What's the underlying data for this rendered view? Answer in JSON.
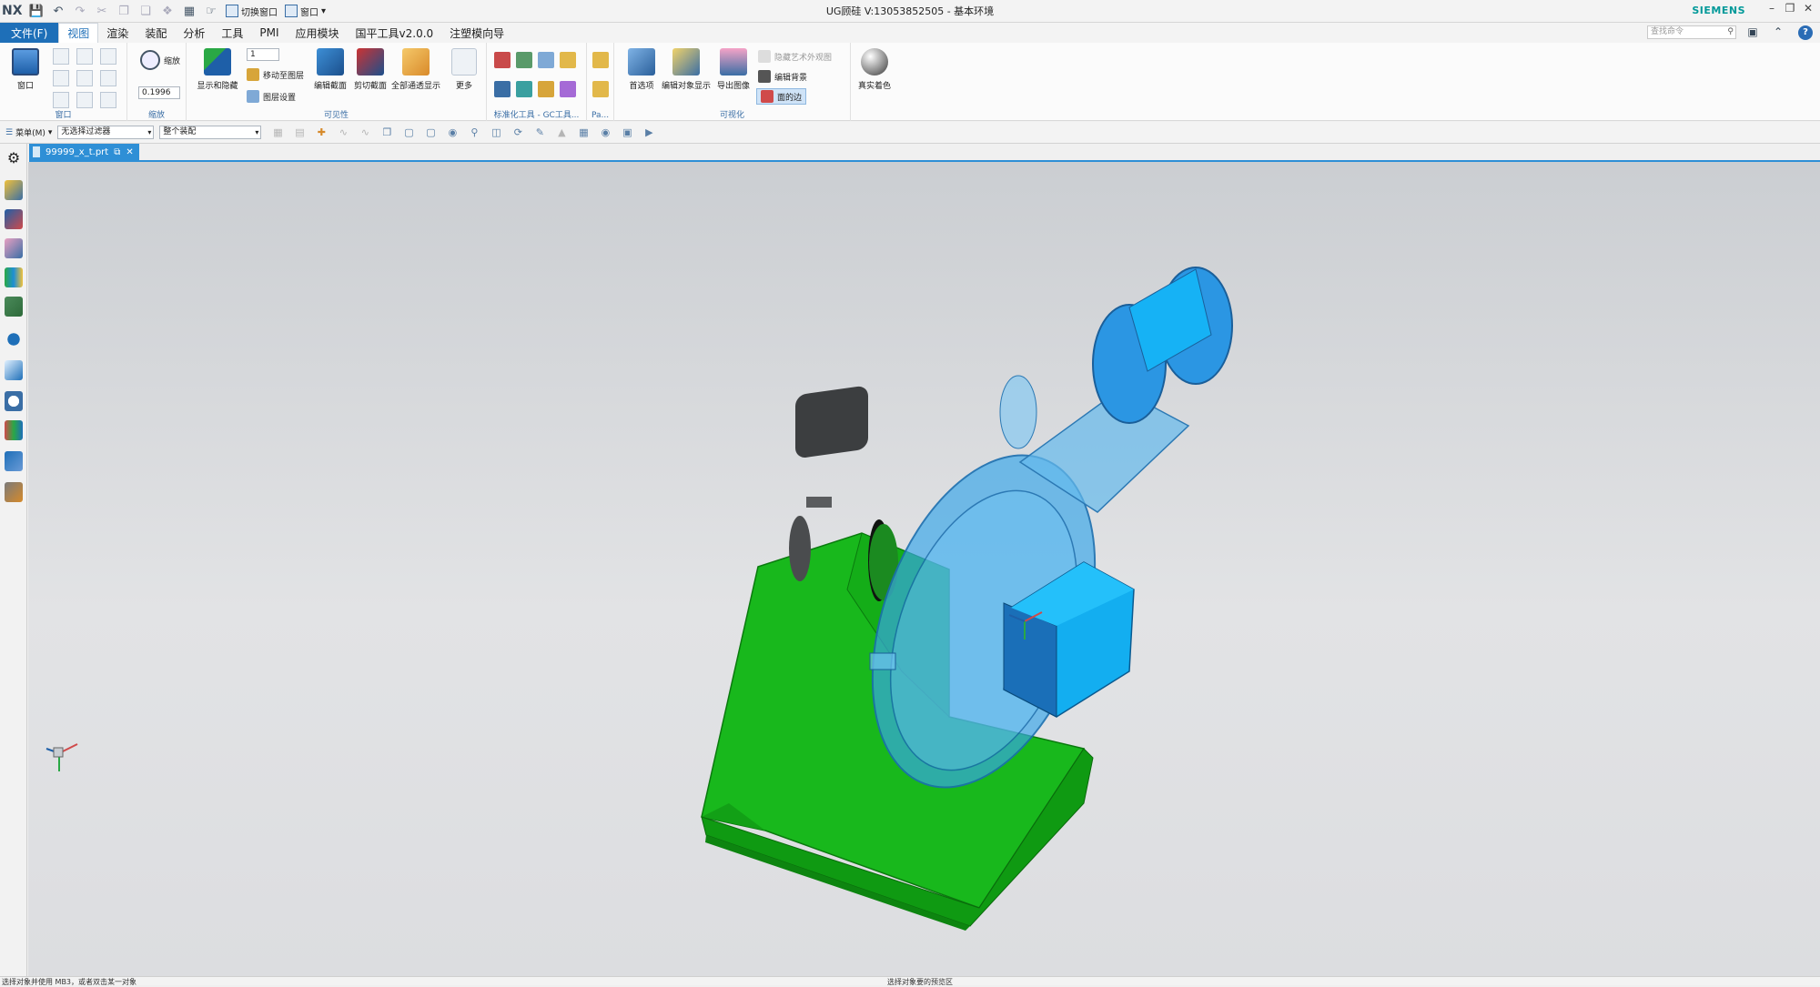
{
  "titlebar": {
    "logo": "NX",
    "switch_window": "切换窗口",
    "window": "窗口",
    "title": "UG顾硅    V:13053852505 - 基本环境",
    "brand": "SIEMENS"
  },
  "menubar": {
    "file": "文件(F)",
    "tabs": [
      "视图",
      "渲染",
      "装配",
      "分析",
      "工具",
      "PMI",
      "应用模块",
      "国平工具v2.0.0",
      "注塑模向导"
    ],
    "search_placeholder": "查找命令"
  },
  "ribbon": {
    "window_group": {
      "label": "窗口",
      "button": "窗口"
    },
    "zoom_group": {
      "label": "缩放",
      "zoom_btn": "缩放",
      "scale_value": "0.1996"
    },
    "visibility_group": {
      "label": "可见性",
      "layer_value": "1",
      "show_hide": "显示和隐藏",
      "move_to_layer": "移动至图层",
      "layer_settings": "图层设置",
      "edit_section": "编辑截面",
      "clip_section": "剪切截面",
      "all_transparent": "全部通透显示",
      "more": "更多"
    },
    "std_tools_label": "标准化工具 - GC工具...",
    "pa_label": "Pa...",
    "visualization_group": {
      "label": "可视化",
      "preferences": "首选项",
      "edit_object_display": "编辑对象显示",
      "export_image": "导出图像",
      "art_appearance": "隐藏艺术外观图",
      "edit_background": "编辑背景",
      "face_edges": "面的边"
    },
    "true_shading": "真实着色"
  },
  "toolbar2": {
    "menu": "菜单(M)",
    "filter": "无选择过滤器",
    "assembly": "整个装配"
  },
  "document": {
    "tab_name": "99999_x_t.prt"
  },
  "status": {
    "left": "选择对象并使用 MB3，或者双击某一对象",
    "center": "选择对象要的预览区"
  }
}
